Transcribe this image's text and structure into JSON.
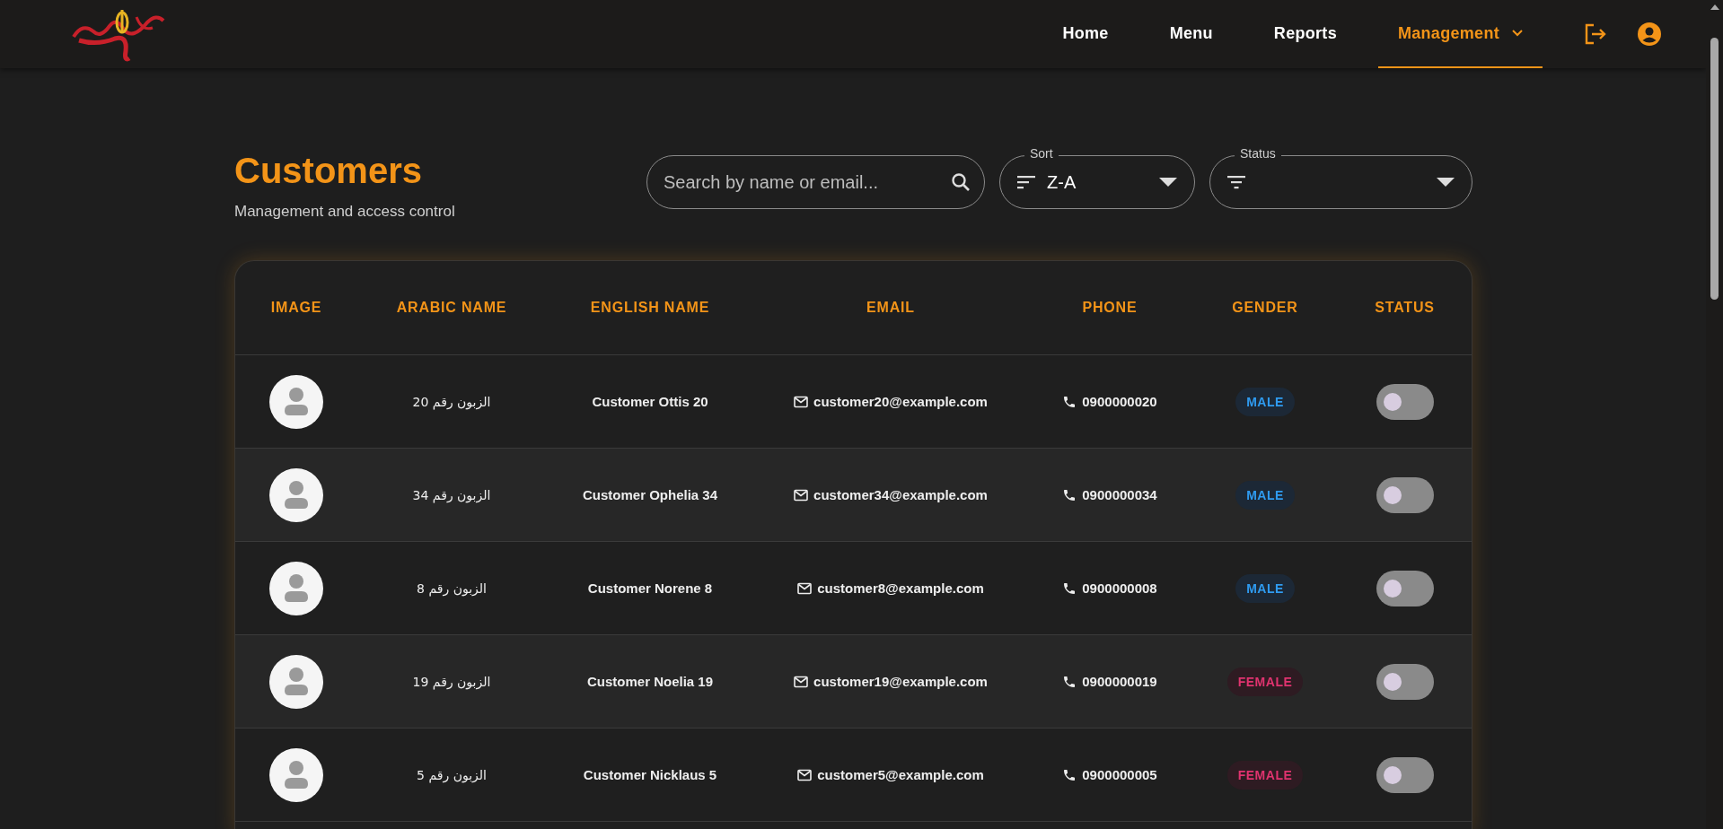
{
  "nav": {
    "items": [
      {
        "label": "Home",
        "selected": false,
        "dropdown": false
      },
      {
        "label": "Menu",
        "selected": false,
        "dropdown": false
      },
      {
        "label": "Reports",
        "selected": false,
        "dropdown": false
      },
      {
        "label": "Management",
        "selected": true,
        "dropdown": true
      }
    ]
  },
  "page": {
    "title": "Customers",
    "subtitle": "Management and access control"
  },
  "search": {
    "placeholder": "Search by name or email..."
  },
  "sort": {
    "label": "Sort",
    "value": "Z-A"
  },
  "status_filter": {
    "label": "Status"
  },
  "table": {
    "columns": [
      "IMAGE",
      "ARABIC NAME",
      "ENGLISH NAME",
      "EMAIL",
      "PHONE",
      "GENDER",
      "STATUS"
    ],
    "rows": [
      {
        "arabic_name": "الزبون رقم 20",
        "english_name": "Customer Ottis 20",
        "email": "customer20@example.com",
        "phone": "0900000020",
        "gender": {
          "label": "MALE",
          "kind": "male"
        },
        "on": false
      },
      {
        "arabic_name": "الزبون رقم 34",
        "english_name": "Customer Ophelia 34",
        "email": "customer34@example.com",
        "phone": "0900000034",
        "gender": {
          "label": "MALE",
          "kind": "male"
        },
        "on": false
      },
      {
        "arabic_name": "الزبون رقم 8",
        "english_name": "Customer Norene 8",
        "email": "customer8@example.com",
        "phone": "0900000008",
        "gender": {
          "label": "MALE",
          "kind": "male"
        },
        "on": false
      },
      {
        "arabic_name": "الزبون رقم 19",
        "english_name": "Customer Noelia 19",
        "email": "customer19@example.com",
        "phone": "0900000019",
        "gender": {
          "label": "FEMALE",
          "kind": "female"
        },
        "on": false
      },
      {
        "arabic_name": "الزبون رقم 5",
        "english_name": "Customer Nicklaus 5",
        "email": "customer5@example.com",
        "phone": "0900000005",
        "gender": {
          "label": "FEMALE",
          "kind": "female"
        },
        "on": false
      }
    ]
  }
}
